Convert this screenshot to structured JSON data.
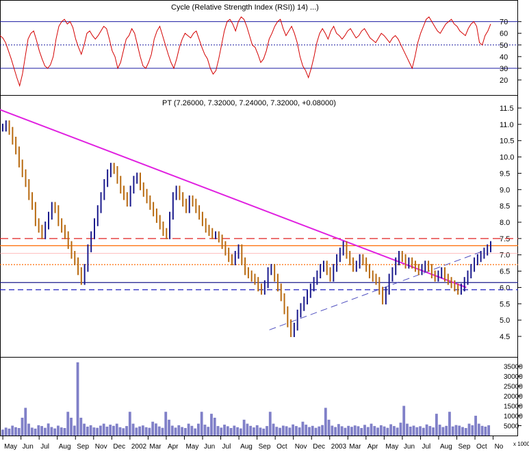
{
  "colors": {
    "rsi_line": "#d40000",
    "price_up": "#1a1a8c",
    "price_down": "#b86a10",
    "trendline": "#e020e0",
    "resistance": "#ff6a00",
    "support": "#1a1a8c",
    "volume": "#8080c8",
    "axis": "#000000"
  },
  "chart_data": [
    {
      "type": "line",
      "panel": "rsi",
      "title": "Cycle (Relative Strength Index (RSI)) 14) ...)",
      "ylim": [
        10,
        78
      ],
      "yticks": [
        20,
        30,
        40,
        50,
        60,
        70
      ],
      "reference_lines": [
        {
          "value": 70,
          "style": "solid"
        },
        {
          "value": 50,
          "style": "dotted"
        },
        {
          "value": 30,
          "style": "solid"
        }
      ],
      "series": [
        {
          "values": [
            58,
            56,
            52,
            45,
            38,
            30,
            22,
            15,
            25,
            40,
            55,
            60,
            62,
            54,
            45,
            38,
            32,
            30,
            33,
            40,
            55,
            66,
            70,
            72,
            68,
            70,
            65,
            55,
            48,
            42,
            50,
            60,
            62,
            58,
            55,
            58,
            62,
            66,
            64,
            55,
            45,
            40,
            30,
            35,
            45,
            55,
            58,
            64,
            60,
            50,
            40,
            32,
            30,
            35,
            42,
            55,
            62,
            66,
            58,
            50,
            42,
            35,
            30,
            38,
            48,
            55,
            60,
            58,
            56,
            60,
            62,
            55,
            48,
            42,
            38,
            30,
            25,
            28,
            38,
            50,
            62,
            70,
            72,
            68,
            62,
            70,
            74,
            72,
            66,
            58,
            50,
            48,
            42,
            35,
            38,
            45,
            55,
            60,
            66,
            70,
            72,
            64,
            58,
            62,
            66,
            60,
            52,
            40,
            32,
            28,
            22,
            30,
            40,
            52,
            60,
            64,
            60,
            55,
            62,
            66,
            60,
            58,
            55,
            58,
            62,
            64,
            60,
            56,
            58,
            62,
            64,
            60,
            56,
            54,
            52,
            56,
            60,
            58,
            55,
            52,
            56,
            58,
            55,
            50,
            45,
            40,
            35,
            30,
            40,
            52,
            60,
            66,
            72,
            74,
            70,
            66,
            62,
            60,
            64,
            68,
            70,
            72,
            68,
            66,
            62,
            60,
            58,
            64,
            68,
            70,
            66,
            52,
            50,
            58,
            62,
            68
          ]
        }
      ]
    },
    {
      "type": "line",
      "panel": "price",
      "title": "PT (7.26000, 7.32000, 7.24000, 7.32000, +0.08000)",
      "ylim": [
        4.0,
        11.8
      ],
      "yticks": [
        4.5,
        5.0,
        5.5,
        6.0,
        6.5,
        7.0,
        7.5,
        8.0,
        8.5,
        9.0,
        9.5,
        10.0,
        10.5,
        11.0,
        11.5
      ],
      "ytick_labels": [
        "4.5",
        "5.0",
        "5.5",
        "6.0",
        "6.5",
        "7.0",
        "7.5",
        "8.0",
        "8.5",
        "9.0",
        "9.5",
        "10.0",
        "10.5",
        "11.0",
        "11.5"
      ],
      "horizontal_lines": [
        {
          "value": 7.5,
          "style": "long-dash",
          "color": "red"
        },
        {
          "value": 7.28,
          "style": "solid",
          "color": "orange"
        },
        {
          "value": 7.05,
          "style": "solid-thin",
          "color": "orange"
        },
        {
          "value": 6.7,
          "style": "dotted",
          "color": "orange"
        },
        {
          "value": 6.15,
          "style": "solid",
          "color": "navy"
        },
        {
          "value": 5.93,
          "style": "dash",
          "color": "blue"
        }
      ],
      "trendlines": [
        {
          "from": [
            0,
            11.45
          ],
          "to": [
            0.9,
            6.0
          ],
          "style": "solid",
          "color": "magenta"
        },
        {
          "from": [
            0.52,
            4.7
          ],
          "to": [
            0.93,
            7.1
          ],
          "style": "dash",
          "color": "blue"
        }
      ],
      "series": [
        {
          "name": "PT",
          "values": [
            10.9,
            11.0,
            10.8,
            10.5,
            10.2,
            9.8,
            9.5,
            9.2,
            8.8,
            8.5,
            8.0,
            7.8,
            7.6,
            7.9,
            8.2,
            8.5,
            8.4,
            8.0,
            7.8,
            7.6,
            7.3,
            7.0,
            6.8,
            6.5,
            6.2,
            6.6,
            7.2,
            7.6,
            8.0,
            8.4,
            8.8,
            9.2,
            9.5,
            9.7,
            9.6,
            9.3,
            9.0,
            8.8,
            8.6,
            9.0,
            9.3,
            9.4,
            9.1,
            8.9,
            8.7,
            8.5,
            8.3,
            8.1,
            7.9,
            7.7,
            7.6,
            8.2,
            8.8,
            9.0,
            8.8,
            8.6,
            8.4,
            8.7,
            8.6,
            8.4,
            8.2,
            8.0,
            7.8,
            7.7,
            7.6,
            7.6,
            7.5,
            7.3,
            7.1,
            6.9,
            6.8,
            7.0,
            7.2,
            6.8,
            6.5,
            6.4,
            6.3,
            6.2,
            6.0,
            5.9,
            6.1,
            6.5,
            6.6,
            6.3,
            6.0,
            5.7,
            5.3,
            4.9,
            4.6,
            4.8,
            5.2,
            5.4,
            5.6,
            5.8,
            6.0,
            6.2,
            6.4,
            6.6,
            6.7,
            6.5,
            6.3,
            6.6,
            6.9,
            7.1,
            7.3,
            7.0,
            6.8,
            6.6,
            6.7,
            6.9,
            6.8,
            6.6,
            6.4,
            6.3,
            6.2,
            5.9,
            5.6,
            5.9,
            6.3,
            6.5,
            6.8,
            7.0,
            6.9,
            6.7,
            6.8,
            6.7,
            6.6,
            6.5,
            6.6,
            6.7,
            6.6,
            6.4,
            6.3,
            6.4,
            6.5,
            6.3,
            6.2,
            6.1,
            6.0,
            5.9,
            6.0,
            6.2,
            6.4,
            6.6,
            6.8,
            6.9,
            7.0,
            7.1,
            7.2,
            7.3
          ]
        }
      ]
    },
    {
      "type": "bar",
      "panel": "volume",
      "ylim": [
        0,
        38000
      ],
      "yticks": [
        5000,
        10000,
        15000,
        20000,
        25000,
        30000,
        35000
      ],
      "ytick_labels": [
        "5000",
        "10000",
        "15000",
        "20000",
        "25000",
        "30000",
        "35000"
      ],
      "unit_label": "x 1000",
      "series": [
        {
          "values": [
            3000,
            4000,
            3500,
            5000,
            4200,
            3800,
            9000,
            14000,
            6000,
            4000,
            3500,
            5200,
            4800,
            3900,
            6100,
            4300,
            3600,
            5000,
            4100,
            3800,
            12000,
            9000,
            5000,
            37000,
            9000,
            6000,
            4500,
            5200,
            4100,
            3900,
            5000,
            6000,
            4500,
            5500,
            4900,
            6000,
            4200,
            3700,
            4800,
            12000,
            6000,
            4000,
            4600,
            5100,
            4200,
            3900,
            7000,
            6100,
            4600,
            3900,
            12000,
            8000,
            5000,
            4000,
            5200,
            4300,
            3800,
            6000,
            4900,
            3600,
            6000,
            12000,
            5500,
            4400,
            11000,
            9000,
            4800,
            4000,
            5500,
            4700,
            3800,
            5000,
            4200,
            3600,
            8000,
            6000,
            4900,
            4100,
            5200,
            4000,
            3500,
            4800,
            12000,
            6000,
            4400,
            3900,
            5000,
            4700,
            4000,
            5600,
            4800,
            4100,
            7000,
            5500,
            4300,
            4900,
            3900,
            4600,
            5300,
            14000,
            8000,
            5000,
            4300,
            5800,
            4700,
            3900,
            4900,
            4400,
            5100,
            4700,
            3800,
            5400,
            4300,
            6000,
            4800,
            4000,
            5200,
            4600,
            3900,
            5700,
            4800,
            4000,
            6500,
            15000,
            6000,
            4500,
            5000,
            4200,
            4700,
            3900,
            5600,
            4800,
            4100,
            11000,
            5500,
            4300,
            4900,
            12000,
            4600,
            5300,
            5000,
            4300,
            3800,
            6000,
            5200,
            10000,
            6000,
            4900,
            4500,
            5200
          ]
        }
      ]
    }
  ],
  "x_labels": [
    "May",
    "Jun",
    "Jul",
    "Aug",
    "Sep",
    "Nov",
    "Dec",
    "2002",
    "Mar",
    "Apr",
    "May",
    "Jun",
    "Jul",
    "Aug",
    "Sep",
    "Oct",
    "Nov",
    "Dec",
    "2003",
    "Mar",
    "Apr",
    "May",
    "Jun",
    "Jul",
    "Aug",
    "Sep",
    "Oct",
    "No"
  ]
}
